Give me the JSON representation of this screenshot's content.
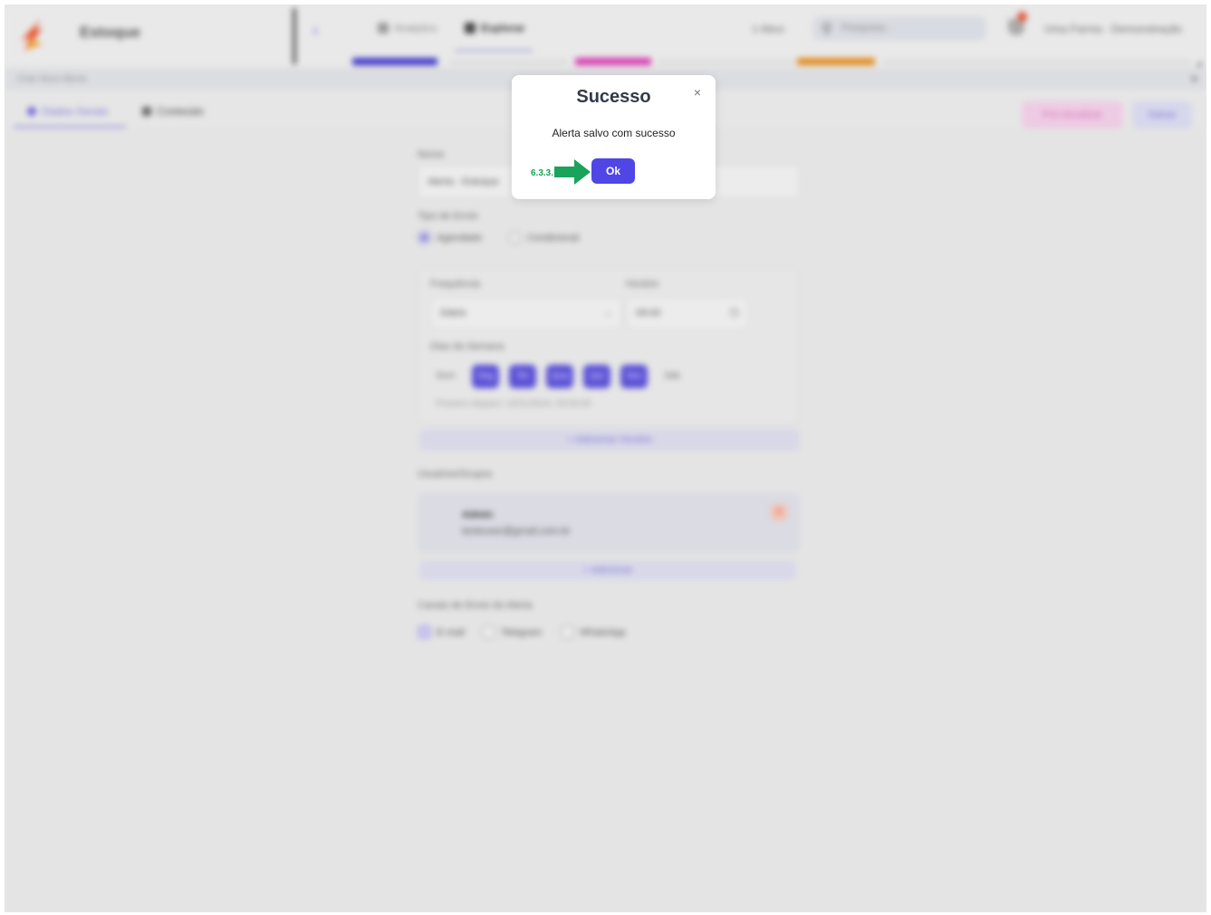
{
  "background": {
    "brand": "Estoque",
    "nav_tabs": [
      "Analytics",
      "Explorar"
    ],
    "top_right": {
      "plan": "1 Ativo",
      "search_placeholder": "Pesquisar...",
      "user": "Uma Farma - Demonstração"
    },
    "subbar_title": "Criar Novo Alerta",
    "subtabs": [
      "Dados Gerais",
      "Conteúdo"
    ],
    "buttons": {
      "preview": "Pré-visualizar",
      "save": "Salvar"
    },
    "form": {
      "name_label": "Nome",
      "name_value": "Alerta - Estoque",
      "send_type_label": "Tipo de Envio",
      "send_types": [
        "Agendado",
        "Condicional"
      ],
      "frequency_label": "Frequência",
      "frequency_value": "Diário",
      "time_label": "Horário",
      "time_value": "09:00",
      "weekdays_label": "Dias da Semana",
      "weekdays": [
        "Dom",
        "Seg",
        "Ter",
        "Qua",
        "Qui",
        "Sex",
        "Sáb"
      ],
      "weekdays_active": [
        false,
        true,
        true,
        true,
        true,
        true,
        false
      ],
      "next_send": "Próximo disparo: 19/11/2024, 09:00:00",
      "add_time": "+ Adicionar Horário",
      "users_label": "Usuários/Grupos",
      "user_name": "Admin",
      "user_email": "testeuser@gmail.com.br",
      "add_user": "+ Adicionar",
      "channels_label": "Canais de Envio do Alerta",
      "channels": [
        "E-mail",
        "Telegram",
        "WhatsApp"
      ]
    }
  },
  "modal": {
    "title": "Sucesso",
    "close_glyph": "×",
    "message": "Alerta salvo com sucesso",
    "ok_label": "Ok"
  },
  "annotation": {
    "step_label": "6.3.3.",
    "color": "#1aa35a"
  },
  "colors": {
    "primary": "#4f46e5",
    "brand_orange": "#e8562f",
    "overlay": "#e6e6e6"
  }
}
